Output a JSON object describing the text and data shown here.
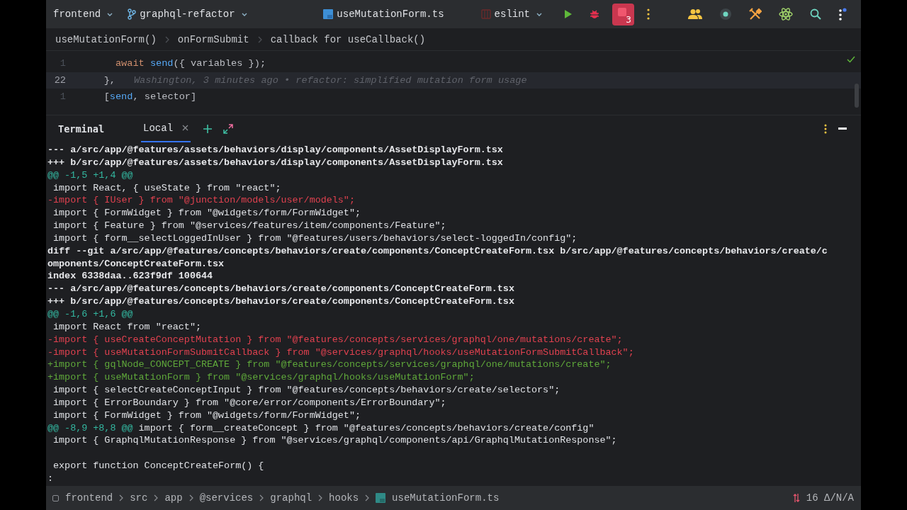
{
  "toolbar": {
    "project": "frontend",
    "branch": "graphql-refactor",
    "file": "useMutationForm.ts",
    "run_config": "eslint",
    "stop_badge": "3"
  },
  "breadcrumbs": [
    "useMutationForm()",
    "onFormSubmit",
    "callback for useCallback()"
  ],
  "editor": {
    "lines": [
      {
        "number": "1",
        "current": false,
        "tokens": [
          {
            "kind": "keyword",
            "text": "      await"
          },
          {
            "kind": "function",
            "text": " send"
          },
          {
            "kind": "plain",
            "text": "({ variables });"
          }
        ]
      },
      {
        "number": "22",
        "current": true,
        "tokens": [
          {
            "kind": "plain",
            "text": "    },"
          },
          {
            "kind": "blame",
            "text": "Washington, 3 minutes ago • refactor: simplified mutation form usage"
          }
        ]
      },
      {
        "number": "1",
        "current": false,
        "tokens": [
          {
            "kind": "plain",
            "text": "    ["
          },
          {
            "kind": "function",
            "text": "send"
          },
          {
            "kind": "plain",
            "text": ", selector]"
          }
        ]
      }
    ]
  },
  "terminal": {
    "title": "Terminal",
    "tabs": [
      {
        "label": "Local",
        "selected": true
      }
    ],
    "lines": [
      {
        "kind": "header",
        "text": "--- a/src/app/@features/assets/behaviors/display/components/AssetDisplayForm.tsx"
      },
      {
        "kind": "header",
        "text": "+++ b/src/app/@features/assets/behaviors/display/components/AssetDisplayForm.tsx"
      },
      {
        "kind": "hunk",
        "text": "@@ -1,5 +1,4 @@"
      },
      {
        "kind": "context",
        "text": " import React, { useState } from \"react\";"
      },
      {
        "kind": "removed",
        "text": "-import { IUser } from \"@junction/models/user/models\";"
      },
      {
        "kind": "context",
        "text": " import { FormWidget } from \"@widgets/form/FormWidget\";"
      },
      {
        "kind": "context",
        "text": " import { Feature } from \"@services/features/item/components/Feature\";"
      },
      {
        "kind": "context",
        "text": " import { form__selectLoggedInUser } from \"@features/users/behaviors/select-loggedIn/config\";"
      },
      {
        "kind": "header",
        "text": "diff --git a/src/app/@features/concepts/behaviors/create/components/ConceptCreateForm.tsx b/src/app/@features/concepts/behaviors/create/c"
      },
      {
        "kind": "header",
        "text": "omponents/ConceptCreateForm.tsx"
      },
      {
        "kind": "header",
        "text": "index 6338daa..623f9df 100644"
      },
      {
        "kind": "header",
        "text": "--- a/src/app/@features/concepts/behaviors/create/components/ConceptCreateForm.tsx"
      },
      {
        "kind": "header",
        "text": "+++ b/src/app/@features/concepts/behaviors/create/components/ConceptCreateForm.tsx"
      },
      {
        "kind": "hunk",
        "text": "@@ -1,6 +1,6 @@"
      },
      {
        "kind": "context",
        "text": " import React from \"react\";"
      },
      {
        "kind": "removed",
        "text": "-import { useCreateConceptMutation } from \"@features/concepts/services/graphql/one/mutations/create\";"
      },
      {
        "kind": "removed",
        "text": "-import { useMutationFormSubmitCallback } from \"@services/graphql/hooks/useMutationFormSubmitCallback\";"
      },
      {
        "kind": "added",
        "text": "+import { gqlNode_CONCEPT_CREATE } from \"@features/concepts/services/graphql/one/mutations/create\";"
      },
      {
        "kind": "added",
        "text": "+import { useMutationForm } from \"@services/graphql/hooks/useMutationForm\";"
      },
      {
        "kind": "context",
        "text": " import { selectCreateConceptInput } from \"@features/concepts/behaviors/create/selectors\";"
      },
      {
        "kind": "context",
        "text": " import { ErrorBoundary } from \"@core/error/components/ErrorBoundary\";"
      },
      {
        "kind": "context",
        "text": " import { FormWidget } from \"@widgets/form/FormWidget\";"
      },
      {
        "kind": "hunk",
        "text": "@@ -8,9 +8,8 @@",
        "rest": " import { form__createConcept } from \"@features/concepts/behaviors/create/config\""
      },
      {
        "kind": "context",
        "text": " import { GraphqlMutationResponse } from \"@services/graphql/components/api/GraphqlMutationResponse\";"
      },
      {
        "kind": "blank"
      },
      {
        "kind": "context",
        "text": " export function ConceptCreateForm() {"
      },
      {
        "kind": "prompt",
        "text": ":"
      }
    ]
  },
  "status_bar": {
    "path": [
      "frontend",
      "src",
      "app",
      "@services",
      "graphql",
      "hooks"
    ],
    "file": "useMutationForm.ts",
    "vcs": "16 Δ/N/A"
  }
}
